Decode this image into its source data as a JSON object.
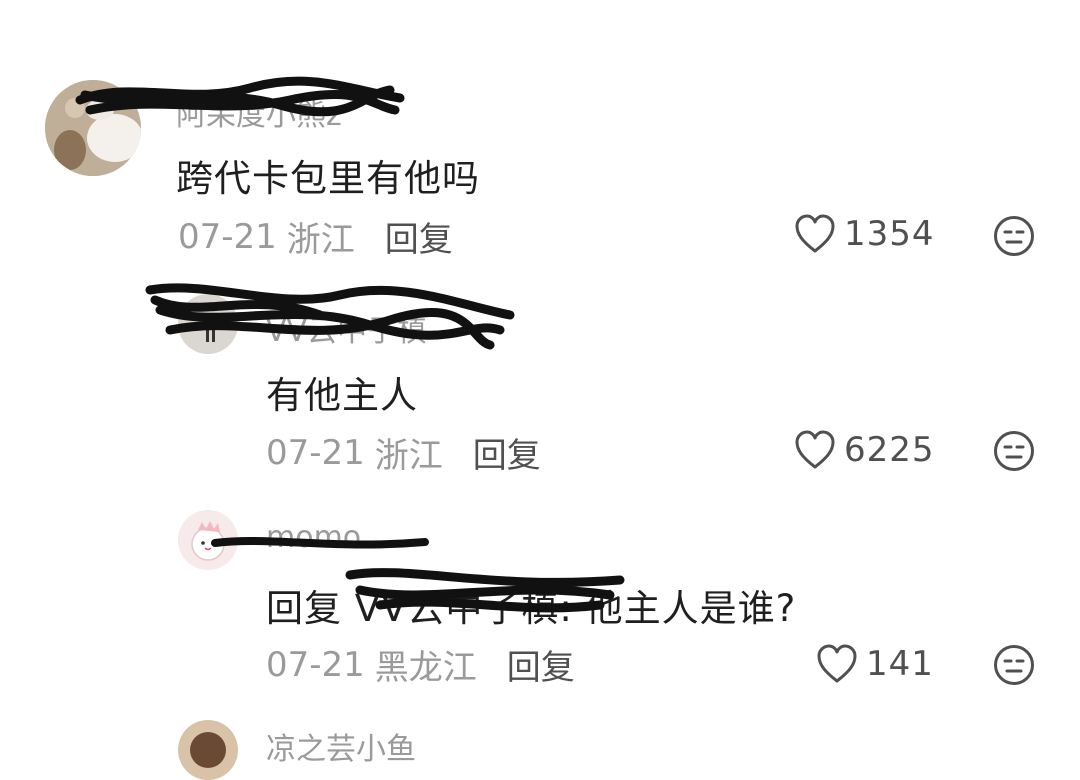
{
  "comments": [
    {
      "username": "阿呆度小熊z",
      "text": "跨代卡包里有他吗",
      "date": "07-21",
      "location": "浙江",
      "reply_label": "回复",
      "likes": "1354"
    },
    {
      "username": "VV云中子槙",
      "text": "有他主人",
      "date": "07-21",
      "location": "浙江",
      "reply_label": "回复",
      "likes": "6225"
    },
    {
      "username": "momo",
      "text_prefix": "回复 VV云中子槙",
      "text_suffix": ": 他主人是谁?",
      "date": "07-21",
      "location": "黑龙江",
      "reply_label": "回复",
      "likes": "141"
    },
    {
      "username": "凉之芸小鱼"
    }
  ],
  "icons": {
    "like": "heart-outline-icon",
    "dislike": "neutral-face-icon"
  },
  "colors": {
    "background": "#ffffff",
    "primary_text": "#1f1f1f",
    "secondary_text": "#9a9a9a",
    "action_text": "#505050",
    "redaction": "#111111"
  }
}
